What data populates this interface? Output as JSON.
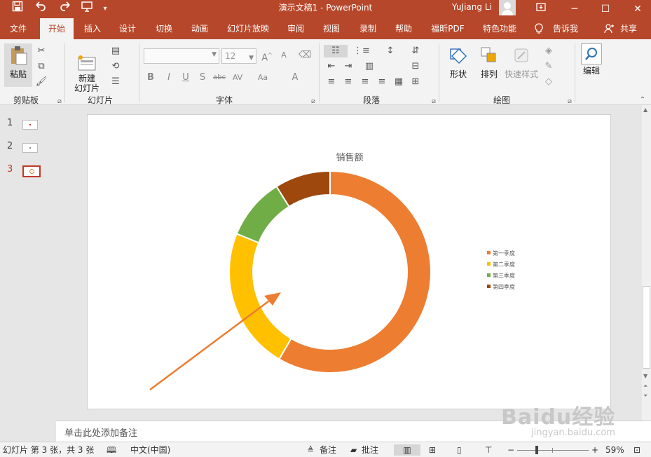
{
  "titlebar": {
    "doc_title": "演示文稿1  -  PowerPoint",
    "user_name": "YuJiang Li",
    "icons": [
      "save-icon",
      "undo-icon",
      "redo-icon",
      "present-icon",
      "customize-icon",
      "ribbon-options-icon",
      "minimize-icon",
      "maximize-icon",
      "close-icon"
    ]
  },
  "tabs": [
    {
      "label": "文件"
    },
    {
      "label": "开始"
    },
    {
      "label": "插入"
    },
    {
      "label": "设计"
    },
    {
      "label": "切换"
    },
    {
      "label": "动画"
    },
    {
      "label": "幻灯片放映"
    },
    {
      "label": "审阅"
    },
    {
      "label": "视图"
    },
    {
      "label": "录制"
    },
    {
      "label": "帮助"
    },
    {
      "label": "福昕PDF"
    },
    {
      "label": "特色功能"
    },
    {
      "label": "告诉我"
    },
    {
      "label": "共享"
    }
  ],
  "ribbon": {
    "paste_label": "粘贴",
    "new_slide_label": "新建\n幻灯片",
    "font_size": "12",
    "shape_label": "形状",
    "arrange_label": "排列",
    "quick_style_label": "快速样式",
    "edit_label": "编辑",
    "groups": [
      "剪贴板",
      "幻灯片",
      "字体",
      "段落",
      "绘图"
    ]
  },
  "slides": [
    "1",
    "2",
    "3"
  ],
  "chart_data": {
    "type": "pie",
    "variant": "doughnut",
    "title": "销售额",
    "categories": [
      "第一季度",
      "第二季度",
      "第三季度",
      "第四季度"
    ],
    "values": [
      59,
      23,
      10,
      9
    ],
    "colors": [
      "#ed7d31",
      "#ffc000",
      "#70ad47",
      "#9e480e"
    ],
    "legend_position": "right"
  },
  "notes_placeholder": "单击此处添加备注",
  "status": {
    "slide_info": "幻灯片 第 3 张，共 3 张",
    "language": "中文(中国)",
    "notes_label": "备注",
    "comments_label": "批注",
    "zoom_level": 0.59,
    "zoom_text": "59%"
  },
  "watermark": {
    "brand": "Baidu经验",
    "url": "jingyan.baidu.com"
  },
  "colors": {
    "brand": "#b7472a",
    "arrow": "#ed7d31"
  }
}
